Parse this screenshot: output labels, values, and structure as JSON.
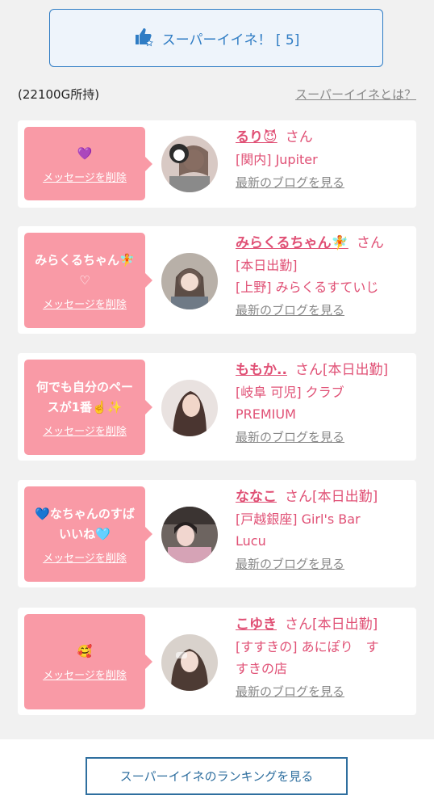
{
  "top_button": {
    "label": "スーパーイイネ！ [ 5]"
  },
  "balance": "(22100G所持)",
  "about_link": "スーパーイイネとは？",
  "cards": [
    {
      "message_lines": [
        "💜"
      ],
      "delete_label": "メッセージを削除",
      "name": "るり😈",
      "san": "さん",
      "lines": [
        "[関内] Jupiter"
      ],
      "blog_label": "最新のブログを見る"
    },
    {
      "message_lines": [
        "みらくるちゃん🧚",
        "♡"
      ],
      "delete_label": "メッセージを削除",
      "name": "みらくるちゃん🧚",
      "san": "さん",
      "lines": [
        "[本日出勤]",
        "[上野] みらくるすていじ"
      ],
      "blog_label": "最新のブログを見る"
    },
    {
      "message_lines": [
        "何でも自分のペー",
        "スが1番☝️✨"
      ],
      "delete_label": "メッセージを削除",
      "name": "ももか..",
      "san": "さん[本日出勤]",
      "lines": [
        "[岐阜 可児] クラブ",
        "PREMIUM"
      ],
      "blog_label": "最新のブログを見る"
    },
    {
      "message_lines": [
        "💙なちゃんのすば",
        "いいね🩵"
      ],
      "delete_label": "メッセージを削除",
      "name": "ななこ",
      "san": "さん[本日出勤]",
      "lines": [
        "[戸越銀座] Girl's Bar",
        "Lucu"
      ],
      "blog_label": "最新のブログを見る"
    },
    {
      "message_lines": [
        "🥰"
      ],
      "delete_label": "メッセージを削除",
      "name": "こゆき",
      "san": "さん[本日出勤]",
      "lines": [
        "[すすきの] あにぽり　す",
        "すきの店"
      ],
      "blog_label": "最新のブログを見る"
    }
  ],
  "ranking_button": "スーパーイイネのランキングを見る",
  "colors": {
    "accent_blue": "#2f7cc4",
    "pink": "#f99aa6",
    "name_pink": "#e05075"
  }
}
